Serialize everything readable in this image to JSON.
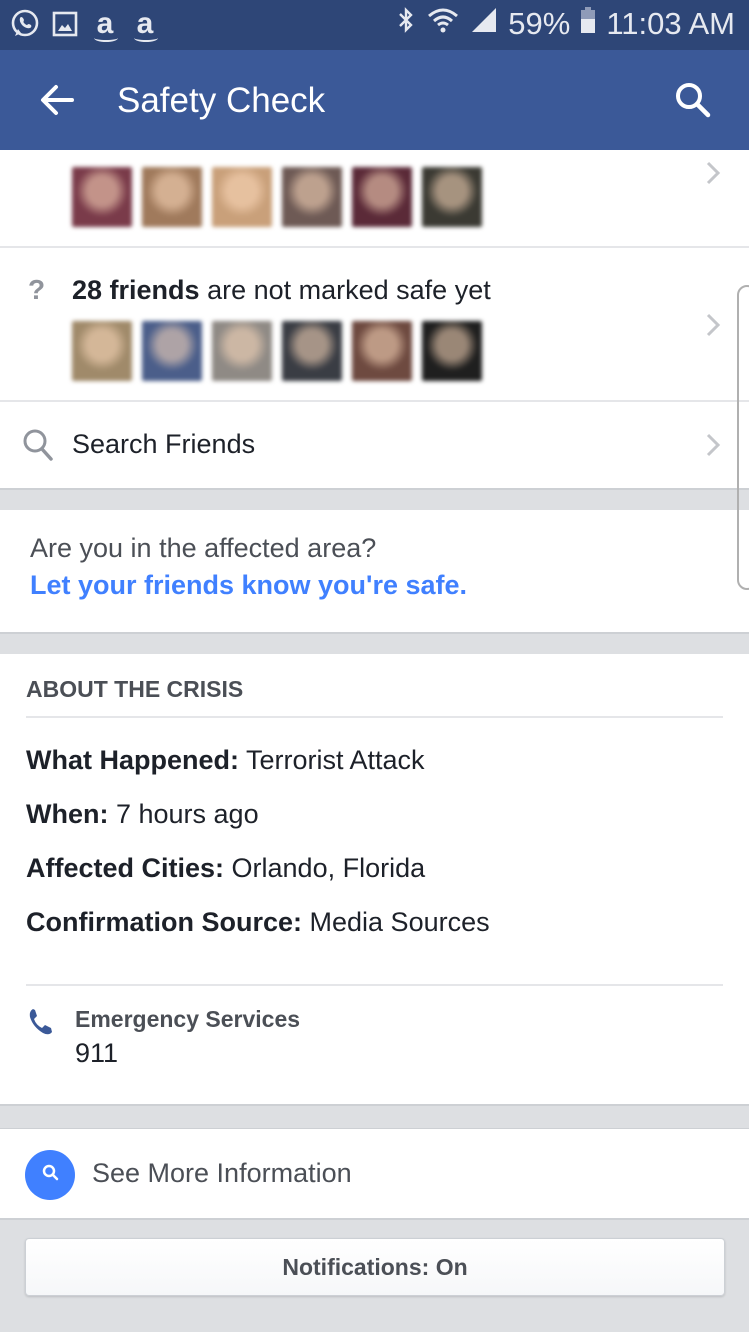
{
  "status_bar": {
    "left_icons": [
      "whatsapp-icon",
      "gallery-icon",
      "amazon-icon",
      "amazon-icon"
    ],
    "amazon_glyph": "a",
    "right_icons": [
      "bluetooth-icon",
      "wifi-icon",
      "signal-icon"
    ],
    "battery": "59%",
    "time": "11:03 AM"
  },
  "app_bar": {
    "title": "Safety Check",
    "back_icon": "arrow-left-icon",
    "search_icon": "search-icon"
  },
  "marked_safe": {
    "avatar_colors": [
      "#7a3b4a",
      "#a07a5c",
      "#c9a07a",
      "#6e5a55",
      "#5b2a38",
      "#3b3a33"
    ]
  },
  "not_marked": {
    "icon": "?",
    "count_label": "28 friends",
    "rest_label": " are not marked safe yet",
    "avatar_colors": [
      "#a08a6a",
      "#4b5e8a",
      "#8f8a85",
      "#3a3d44",
      "#6e4a40",
      "#1f1f1f"
    ]
  },
  "search_friends": {
    "label": "Search Friends"
  },
  "prompt": {
    "question": "Are you in the affected area?",
    "link": "Let your friends know you're safe."
  },
  "crisis": {
    "heading": "ABOUT THE CRISIS",
    "items": [
      {
        "label": "What Happened:",
        "value": " Terrorist Attack"
      },
      {
        "label": "When:",
        "value": " 7 hours ago"
      },
      {
        "label": "Affected Cities:",
        "value": " Orlando, Florida"
      },
      {
        "label": "Confirmation Source:",
        "value": " Media Sources"
      }
    ],
    "emergency": {
      "label": "Emergency Services",
      "number": "911"
    }
  },
  "see_more": {
    "label": "See More Information"
  },
  "notifications_button": {
    "label": "Notifications: On"
  },
  "colors": {
    "brand": "#3b5998",
    "status_bar": "#2e4677",
    "link": "#4080ff",
    "background": "#dddfe2"
  }
}
